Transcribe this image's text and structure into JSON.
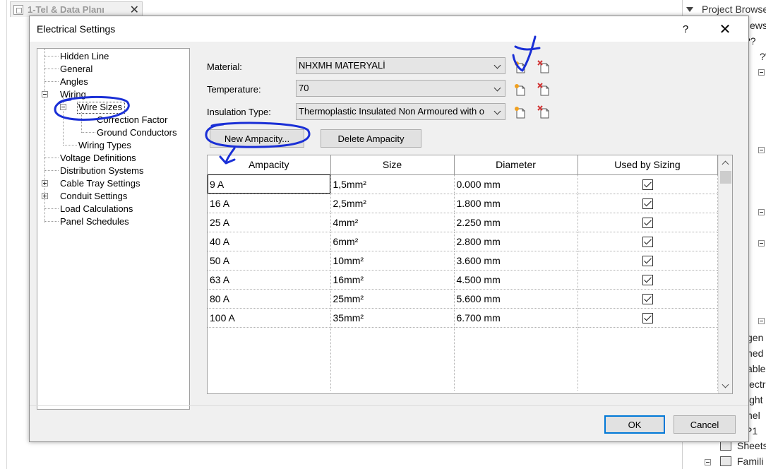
{
  "background": {
    "tab_title": "1-Tel & Data Planı",
    "browser_title": "Project Browser",
    "tree_fragments": [
      "ews",
      "??",
      "?'",
      "gen",
      "hed",
      "able",
      "lectr",
      "ight",
      "nel",
      "P1",
      "Sheets",
      "Famili"
    ]
  },
  "dialog": {
    "title": "Electrical Settings",
    "help": "?",
    "close": "✕"
  },
  "tree": {
    "items": [
      {
        "label": "Hidden Line"
      },
      {
        "label": "General"
      },
      {
        "label": "Angles"
      },
      {
        "label": "Wiring"
      },
      {
        "label": "Wire Sizes"
      },
      {
        "label": "Correction Factor"
      },
      {
        "label": "Ground Conductors"
      },
      {
        "label": "Wiring Types"
      },
      {
        "label": "Voltage Definitions"
      },
      {
        "label": "Distribution Systems"
      },
      {
        "label": "Cable Tray Settings"
      },
      {
        "label": "Conduit Settings"
      },
      {
        "label": "Load Calculations"
      },
      {
        "label": "Panel Schedules"
      }
    ]
  },
  "form": {
    "material_label": "Material:",
    "material_value": "NHXMH MATERYALİ",
    "temperature_label": "Temperature:",
    "temperature_value": "70",
    "insulation_label": "Insulation Type:",
    "insulation_value": "Thermoplastic Insulated Non Armoured with o",
    "new_ampacity": "New Ampacity...",
    "delete_ampacity": "Delete Ampacity"
  },
  "table": {
    "columns": [
      "Ampacity",
      "Size",
      "Diameter",
      "Used by Sizing"
    ],
    "rows": [
      {
        "ampacity": "9 A",
        "size": "1,5mm²",
        "diameter": "0.000 mm",
        "used": true
      },
      {
        "ampacity": "16 A",
        "size": "2,5mm²",
        "diameter": "1.800 mm",
        "used": true
      },
      {
        "ampacity": "25 A",
        "size": "4mm²",
        "diameter": "2.250 mm",
        "used": true
      },
      {
        "ampacity": "40 A",
        "size": "6mm²",
        "diameter": "2.800 mm",
        "used": true
      },
      {
        "ampacity": "50 A",
        "size": "10mm²",
        "diameter": "3.600 mm",
        "used": true
      },
      {
        "ampacity": "63 A",
        "size": "16mm²",
        "diameter": "4.500 mm",
        "used": true
      },
      {
        "ampacity": "80 A",
        "size": "25mm²",
        "diameter": "5.600 mm",
        "used": true
      },
      {
        "ampacity": "100 A",
        "size": "35mm²",
        "diameter": "6.700 mm",
        "used": true
      }
    ]
  },
  "footer": {
    "ok": "OK",
    "cancel": "Cancel"
  },
  "colors": {
    "annotation_ink": "#1a2fd6",
    "accent_focus": "#0078d7",
    "new_icon_star": "#f0a020",
    "delete_icon_x": "#d03030"
  }
}
